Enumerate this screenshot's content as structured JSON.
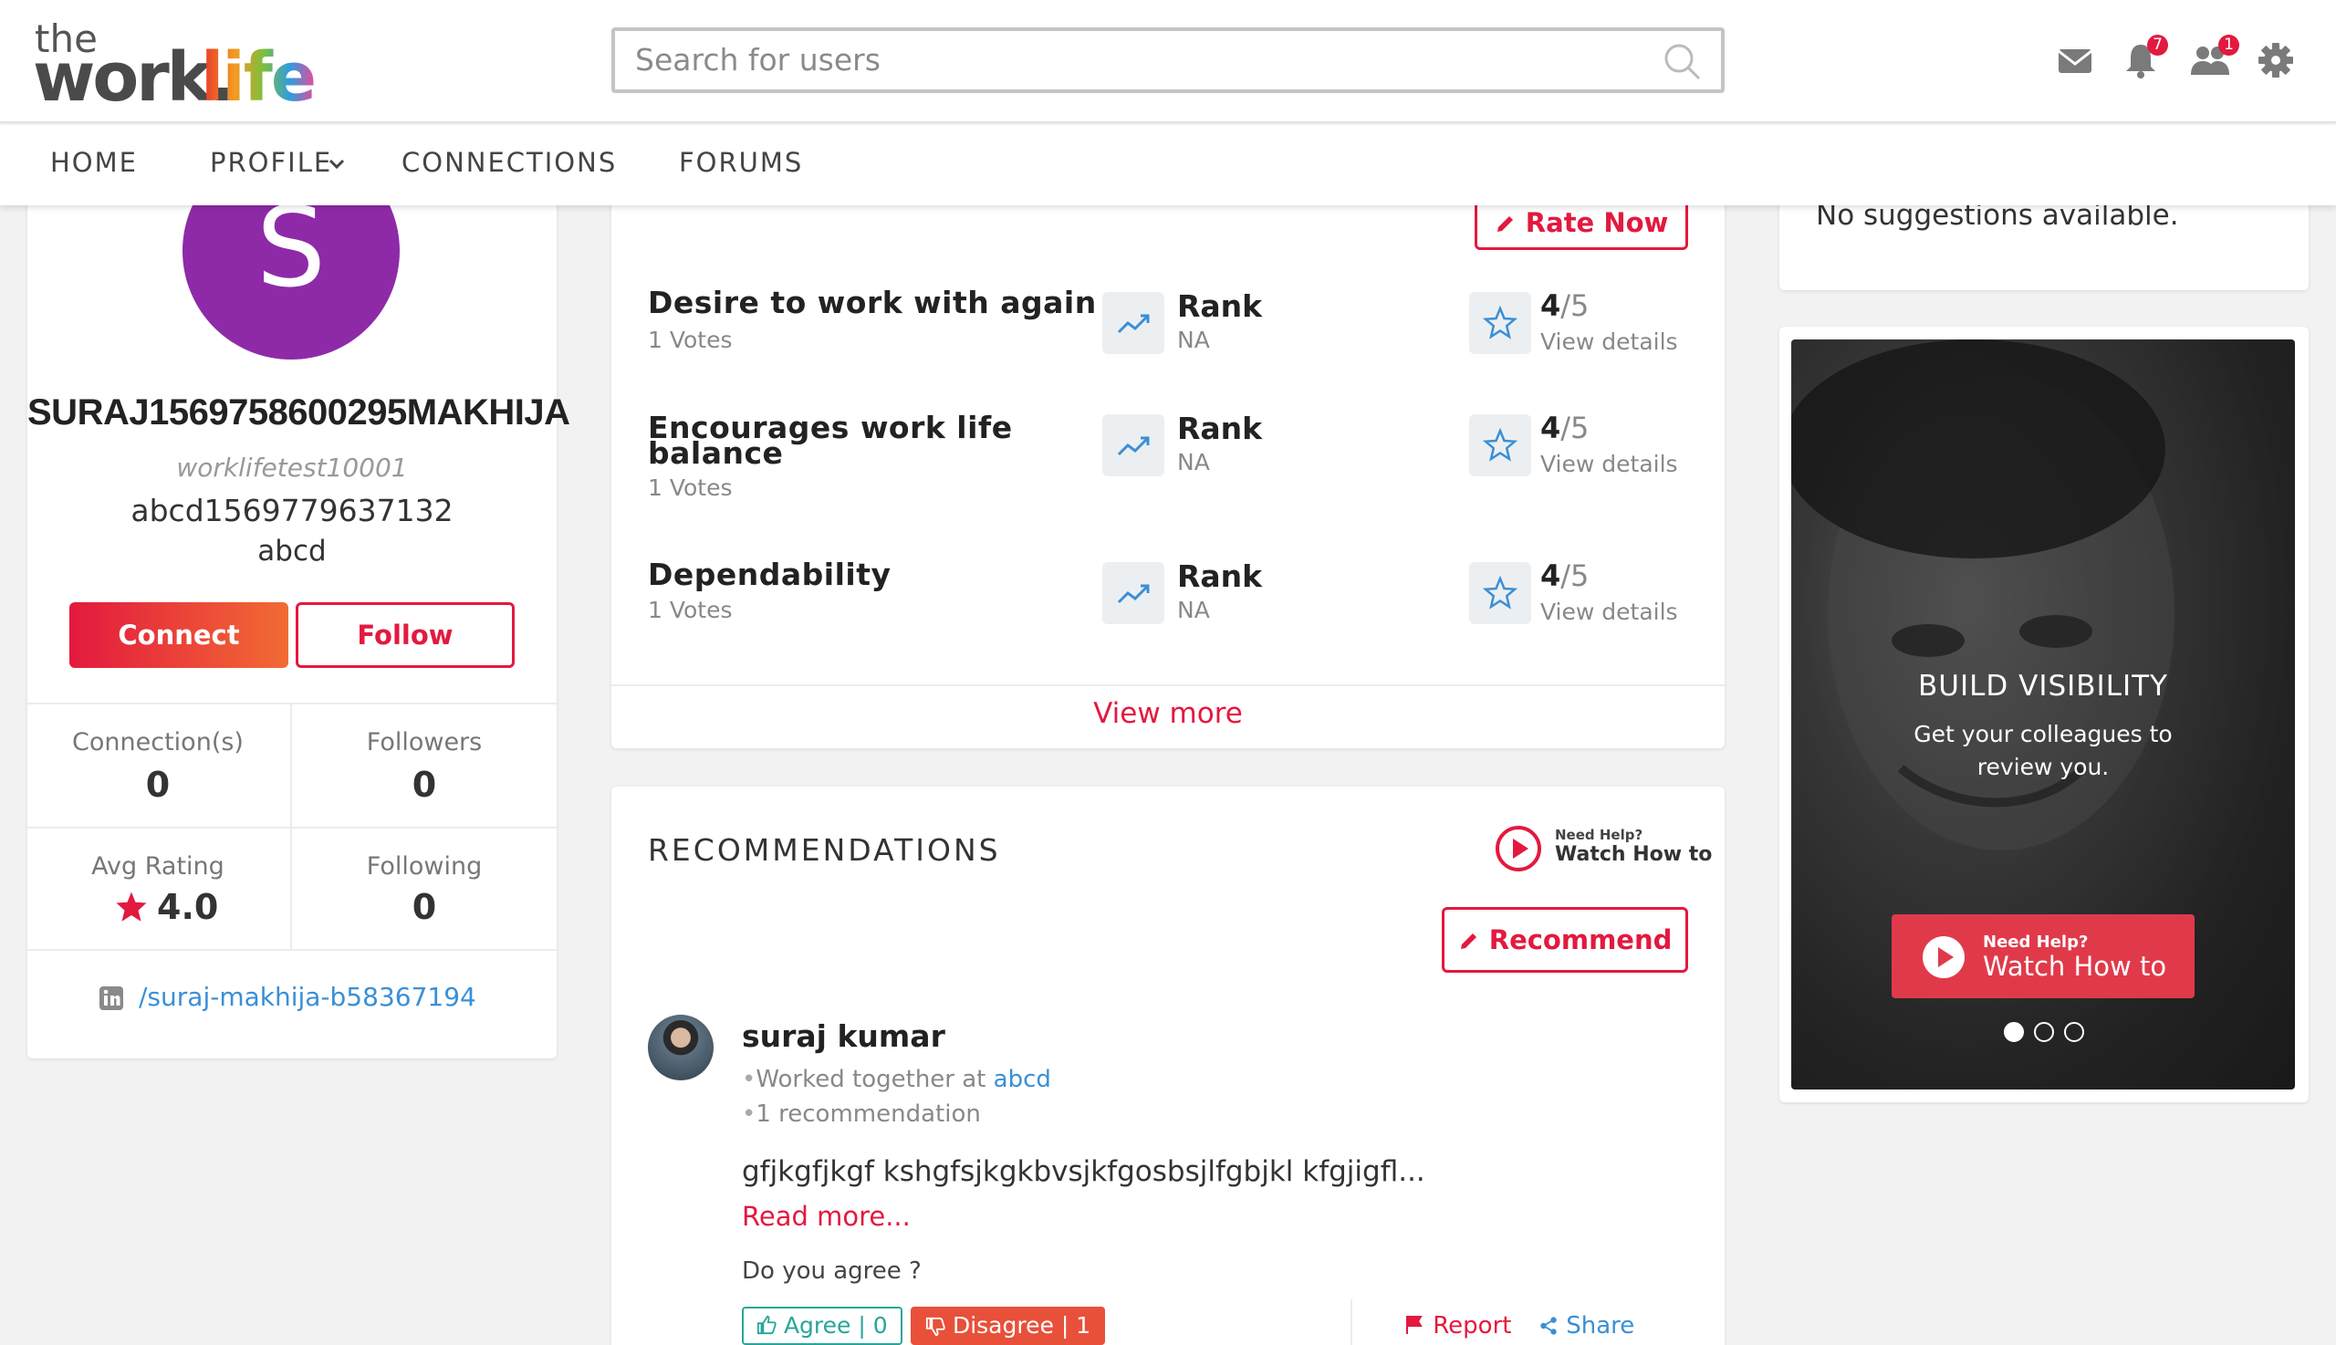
{
  "header": {
    "logo_the": "the",
    "logo_work": "work.",
    "logo_life": "life",
    "search_placeholder": "Search for users",
    "notifications_count": "7",
    "requests_count": "1"
  },
  "nav": {
    "home": "HOME",
    "profile": "PROFILE",
    "connections": "CONNECTIONS",
    "forums": "FORUMS"
  },
  "profile": {
    "initial": "S",
    "name": "SURAJ1569758600295MAKHIJA",
    "username": "worklifetest10001",
    "title": "abcd1569779637132",
    "company": "abcd",
    "connect_label": "Connect",
    "follow_label": "Follow",
    "connections_label": "Connection(s)",
    "connections_value": "0",
    "followers_label": "Followers",
    "followers_value": "0",
    "avg_rating_label": "Avg Rating",
    "avg_rating_value": "4.0",
    "following_label": "Following",
    "following_value": "0",
    "linkedin": "/suraj-makhija-b58367194"
  },
  "ratings": {
    "rate_now_label": "Rate Now",
    "items": [
      {
        "name": "Desire to work with again",
        "votes": "1 Votes",
        "rank_label": "Rank",
        "rank_value": "NA",
        "score": "4",
        "out_of": "/5",
        "details": "View details"
      },
      {
        "name": "Encourages work life balance",
        "votes": "1 Votes",
        "rank_label": "Rank",
        "rank_value": "NA",
        "score": "4",
        "out_of": "/5",
        "details": "View details"
      },
      {
        "name": "Dependability",
        "votes": "1 Votes",
        "rank_label": "Rank",
        "rank_value": "NA",
        "score": "4",
        "out_of": "/5",
        "details": "View details"
      }
    ],
    "view_more": "View more"
  },
  "recommendations": {
    "heading": "RECOMMENDATIONS",
    "help_small": "Need Help?",
    "help_big": "Watch How to",
    "recommend_label": "Recommend",
    "item": {
      "author": "suraj kumar",
      "worked_prefix": "Worked together at ",
      "worked_company": "abcd",
      "count": "1 recommendation",
      "text": "gfjkgfjkgf kshgfsjkgkbvsjkfgosbsjlfgbjkl kfgjigfl...",
      "read_more": "Read more...",
      "question": "Do you agree ?",
      "agree": "Agree",
      "agree_count": "| 0",
      "disagree": "Disagree",
      "disagree_count": "| 1",
      "report": "Report",
      "share": "Share"
    }
  },
  "sidebar": {
    "suggestions_empty": "No suggestions available.",
    "ad_title": "BUILD VISIBILITY",
    "ad_subtitle_1": "Get your colleagues to",
    "ad_subtitle_2": "review you.",
    "ad_help_small": "Need Help?",
    "ad_help_big": "Watch How to"
  },
  "colors": {
    "accent": "#e3193f",
    "avatar": "#8e2aa8",
    "link": "#3a8fd6",
    "agree": "#26a69a",
    "disagree": "#e8503a"
  }
}
